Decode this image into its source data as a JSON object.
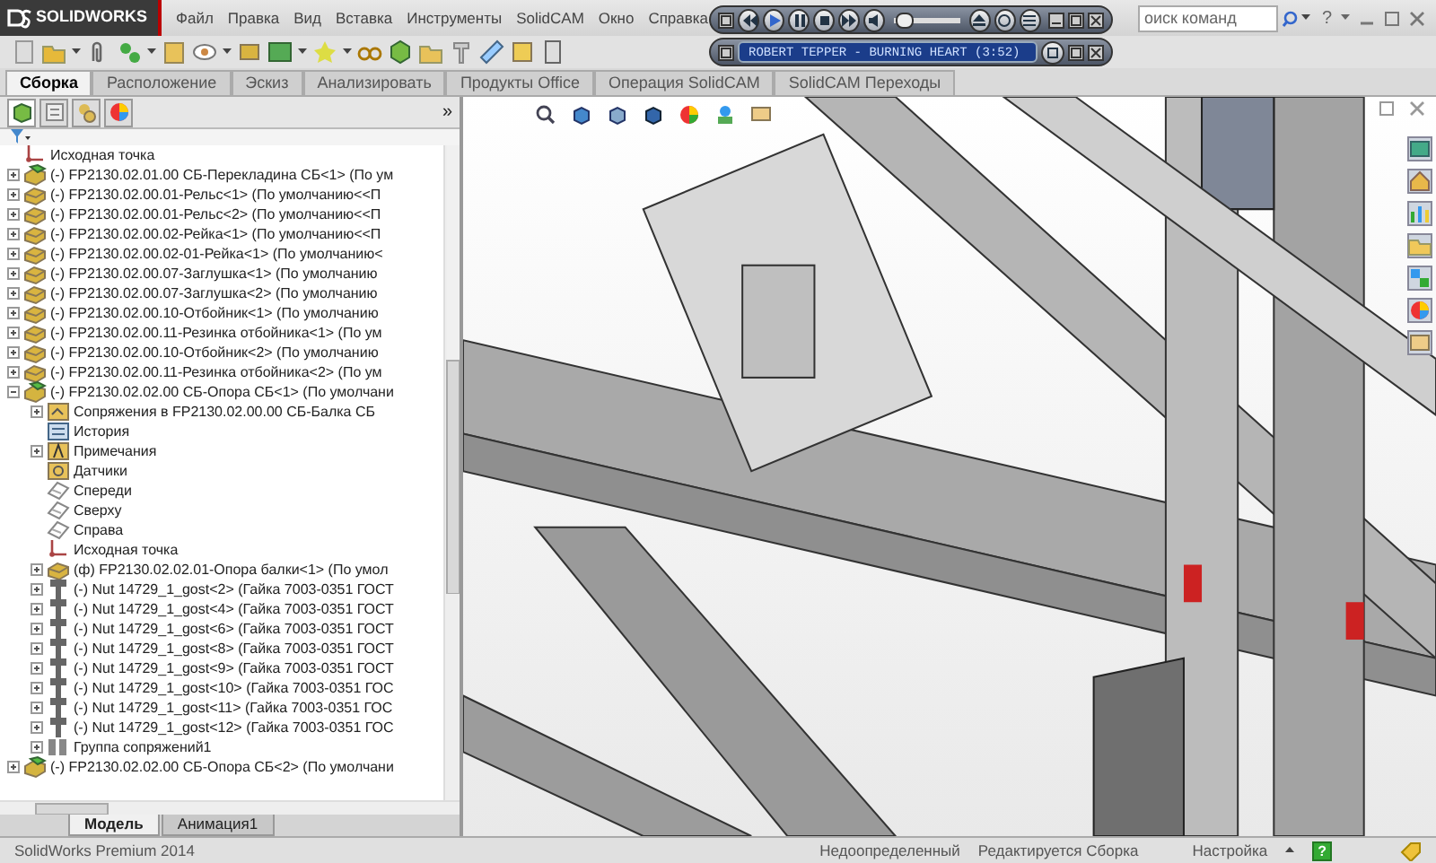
{
  "window": {
    "logo": "SOLIDWORKS",
    "menu": [
      "Файл",
      "Правка",
      "Вид",
      "Вставка",
      "Инструменты",
      "SolidCAM",
      "Окно",
      "Справка"
    ],
    "search": {
      "placeholder": "оиск команд"
    },
    "help_glyph": "?"
  },
  "media_player": {
    "track_title": "ROBERT TEPPER - BURNING HEART (3:52)",
    "volume": {
      "level": 0.15
    }
  },
  "tabs": [
    {
      "label": "Сборка",
      "selected": true
    },
    {
      "label": "Расположение",
      "selected": false
    },
    {
      "label": "Эскиз",
      "selected": false
    },
    {
      "label": "Анализировать",
      "selected": false
    },
    {
      "label": "Продукты Office",
      "selected": false
    },
    {
      "label": "Операция SolidCAM",
      "selected": false
    },
    {
      "label": "SolidCAM Переходы",
      "selected": false
    }
  ],
  "panel": {
    "more_glyph": "»"
  },
  "tree": {
    "items": [
      {
        "kind": "origin",
        "label": "Исходная точка"
      },
      {
        "kind": "subassembly",
        "label": "(-) FP2130.02.01.00 СБ-Перекладина СБ<1> (По ум",
        "expanded": false
      },
      {
        "kind": "part",
        "label": "(-) FP2130.02.00.01-Рельс<1> (По умолчанию<<П",
        "expanded": false
      },
      {
        "kind": "part",
        "label": "(-) FP2130.02.00.01-Рельс<2> (По умолчанию<<П",
        "expanded": false
      },
      {
        "kind": "part",
        "label": "(-) FP2130.02.00.02-Рейка<1> (По умолчанию<<П",
        "expanded": false
      },
      {
        "kind": "part",
        "label": "(-) FP2130.02.00.02-01-Рейка<1> (По умолчанию<",
        "expanded": false
      },
      {
        "kind": "part",
        "label": "(-) FP2130.02.00.07-Заглушка<1> (По умолчанию",
        "expanded": false
      },
      {
        "kind": "part",
        "label": "(-) FP2130.02.00.07-Заглушка<2> (По умолчанию",
        "expanded": false
      },
      {
        "kind": "part",
        "label": "(-) FP2130.02.00.10-Отбойник<1> (По умолчанию",
        "expanded": false
      },
      {
        "kind": "part",
        "label": "(-) FP2130.02.00.11-Резинка отбойника<1> (По ум",
        "expanded": false
      },
      {
        "kind": "part",
        "label": "(-) FP2130.02.00.10-Отбойник<2> (По умолчанию",
        "expanded": false
      },
      {
        "kind": "part",
        "label": "(-) FP2130.02.00.11-Резинка отбойника<2> (По ум",
        "expanded": false
      },
      {
        "kind": "subassembly",
        "label": "(-) FP2130.02.02.00 СБ-Опора СБ<1> (По умолчани",
        "expanded": true,
        "children": [
          {
            "kind": "mates",
            "label": "Сопряжения в FP2130.02.00.00 СБ-Балка СБ",
            "expanded": false
          },
          {
            "kind": "history",
            "label": "История"
          },
          {
            "kind": "annotations",
            "label": "Примечания",
            "expanded": false
          },
          {
            "kind": "sensors",
            "label": "Датчики"
          },
          {
            "kind": "plane",
            "label": "Спереди"
          },
          {
            "kind": "plane",
            "label": "Сверху"
          },
          {
            "kind": "plane",
            "label": "Справа"
          },
          {
            "kind": "origin",
            "label": "Исходная точка"
          },
          {
            "kind": "part",
            "label": "(ф) FP2130.02.02.01-Опора балки<1> (По умол",
            "expanded": false
          },
          {
            "kind": "nut",
            "label": "(-) Nut 14729_1_gost<2> (Гайка 7003-0351 ГОСТ",
            "expanded": false
          },
          {
            "kind": "nut",
            "label": "(-) Nut 14729_1_gost<4> (Гайка 7003-0351 ГОСТ",
            "expanded": false
          },
          {
            "kind": "nut",
            "label": "(-) Nut 14729_1_gost<6> (Гайка 7003-0351 ГОСТ",
            "expanded": false
          },
          {
            "kind": "nut",
            "label": "(-) Nut 14729_1_gost<8> (Гайка 7003-0351 ГОСТ",
            "expanded": false
          },
          {
            "kind": "nut",
            "label": "(-) Nut 14729_1_gost<9> (Гайка 7003-0351 ГОСТ",
            "expanded": false
          },
          {
            "kind": "nut",
            "label": "(-) Nut 14729_1_gost<10> (Гайка 7003-0351 ГОС",
            "expanded": false
          },
          {
            "kind": "nut",
            "label": "(-) Nut 14729_1_gost<11> (Гайка 7003-0351 ГОС",
            "expanded": false
          },
          {
            "kind": "nut",
            "label": "(-) Nut 14729_1_gost<12> (Гайка 7003-0351 ГОС",
            "expanded": false
          },
          {
            "kind": "mate-group",
            "label": "Группа сопряжений1",
            "expanded": false
          }
        ]
      },
      {
        "kind": "subassembly",
        "label": "(-) FP2130.02.02.00 СБ-Опора СБ<2> (По умолчани",
        "expanded": false
      }
    ]
  },
  "bottom_tabs": [
    {
      "label": "Модель",
      "selected": true
    },
    {
      "label": "Анимация1",
      "selected": false
    }
  ],
  "status_bar": {
    "product": "SolidWorks Premium 2014",
    "state": "Недоопределенный",
    "mode": "Редактируется Сборка",
    "units": "Настройка",
    "help_glyph": "?"
  }
}
